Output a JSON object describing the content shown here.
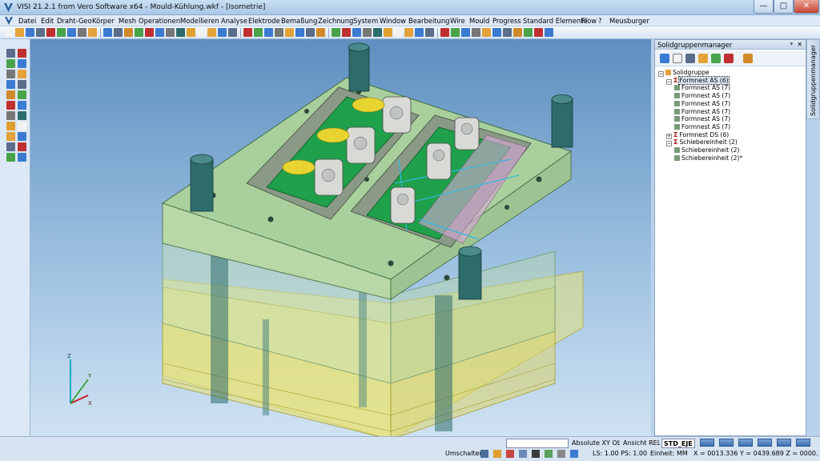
{
  "window": {
    "title": "VISI 21.2.1 from Vero Software x64 - Mould-Kühlung.wkf - [Isometrie]",
    "minimize_glyph": "—",
    "maximize_glyph": "□",
    "close_glyph": "✕"
  },
  "menu": [
    "Datei",
    "Edit",
    "Draht-Geo",
    "Körper",
    "Mesh",
    "Operationen",
    "Modellieren",
    "Analyse",
    "Elektrode",
    "Bemaßung",
    "Zeichnung",
    "System",
    "Window",
    "Bearbeitung",
    "Wire",
    "Mould",
    "Progress",
    "Standard Elemente",
    "Flow",
    "?",
    "Meusburger"
  ],
  "panel": {
    "title": "Solidgruppenmanager",
    "pin_glyph": "ᵠ",
    "close_glyph": "✕",
    "side_tab": "Solidgruppenmanager",
    "tree": [
      {
        "label": "Solidgruppe",
        "level": 0,
        "kind": "root",
        "expanded": true
      },
      {
        "label": "Formnest AS (6)",
        "level": 1,
        "kind": "group",
        "expanded": true,
        "selected": true
      },
      {
        "label": "Formnest AS (7)",
        "level": 2,
        "kind": "item"
      },
      {
        "label": "Formnest AS (7)",
        "level": 2,
        "kind": "item"
      },
      {
        "label": "Formnest AS (7)",
        "level": 2,
        "kind": "item"
      },
      {
        "label": "Formnest AS (7)",
        "level": 2,
        "kind": "item"
      },
      {
        "label": "Formnest AS (7)",
        "level": 2,
        "kind": "item"
      },
      {
        "label": "Formnest AS (7)",
        "level": 2,
        "kind": "item"
      },
      {
        "label": "Formnest DS (6)",
        "level": 1,
        "kind": "group",
        "expanded": false
      },
      {
        "label": "Schiebereinheit (2)",
        "level": 1,
        "kind": "group",
        "expanded": true
      },
      {
        "label": "Schiebereinheit (2)",
        "level": 2,
        "kind": "item"
      },
      {
        "label": "Schiebereinheit (2)*",
        "level": 2,
        "kind": "item"
      }
    ]
  },
  "axes": {
    "x": "X",
    "y": "Y",
    "z": "Z"
  },
  "status": {
    "mode_input_placeholder": "",
    "mode_combo": "Absolute XY Obe",
    "view": "Ansicht REL",
    "layer": "STD_EJE",
    "umschalten": "Umschalten",
    "ls_ps": "LS: 1.00 PS: 1.00",
    "unit": "Einheit: MM",
    "coords": "X = 0013.336 Y = 0439.689 Z = 0000.000"
  },
  "colors": {
    "accent": "#3e6fb0",
    "mould_green": "#b8d8a8",
    "ejector_yellow": "#e8e37a",
    "pillar_teal": "#2e6b6b",
    "cavity_green": "#1fa04a"
  }
}
